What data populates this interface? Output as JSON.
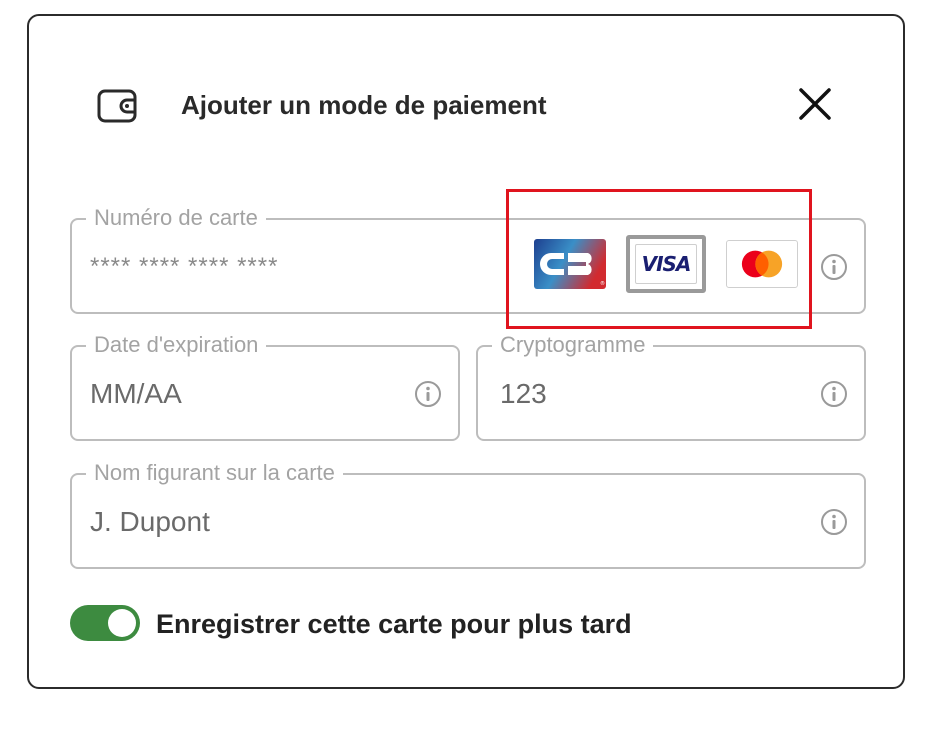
{
  "dialog": {
    "title": "Ajouter un mode de paiement",
    "icons": {
      "header": "wallet-icon",
      "close": "close-icon",
      "info": "info-icon"
    }
  },
  "fields": {
    "card_number": {
      "label": "Numéro de carte",
      "placeholder": "**** **** **** ****"
    },
    "expiry": {
      "label": "Date d'expiration",
      "value": "MM/AA"
    },
    "cvv": {
      "label": "Cryptogramme",
      "value": "123"
    },
    "name": {
      "label": "Nom figurant sur la carte",
      "value": "J. Dupont"
    }
  },
  "card_brands": [
    {
      "name": "CB",
      "text": "CB",
      "selected": false
    },
    {
      "name": "VISA",
      "text": "VISA",
      "selected": true
    },
    {
      "name": "Mastercard",
      "selected": false
    }
  ],
  "save_card": {
    "label": "Enregistrer cette carte pour plus tard",
    "enabled": true
  },
  "colors": {
    "toggle_on": "#3d8b40",
    "highlight": "#e0141e",
    "field_border": "#bdbdbd",
    "label_gray": "#a3a3a3"
  }
}
